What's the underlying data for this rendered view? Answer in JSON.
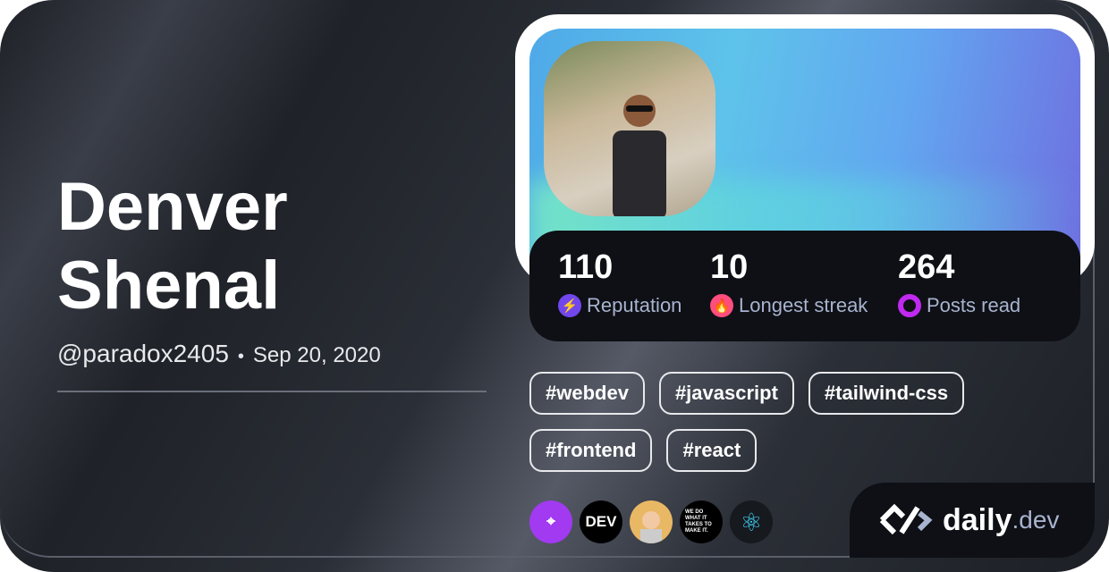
{
  "profile": {
    "first_name": "Denver",
    "last_name": "Shenal",
    "handle": "@paradox2405",
    "separator": "•",
    "joined": "Sep 20, 2020"
  },
  "stats": [
    {
      "value": "110",
      "label": "Reputation",
      "icon": "lightning-icon",
      "color": "#7147ed"
    },
    {
      "value": "10",
      "label": "Longest streak",
      "icon": "flame-icon",
      "color": "#ff4d7e"
    },
    {
      "value": "264",
      "label": "Posts read",
      "icon": "ring-icon",
      "color": "#c029f0"
    }
  ],
  "tags": [
    "#webdev",
    "#javascript",
    "#tailwind-css",
    "#frontend",
    "#react"
  ],
  "squads": [
    {
      "name": "crosshair-squad",
      "color": "#a13af0"
    },
    {
      "name": "DEV",
      "label": "DEV",
      "color": "#000000"
    },
    {
      "name": "avatar-squad",
      "color": "#e9b865"
    },
    {
      "name": "we-do-what-it-takes",
      "label": "WE DO WHAT IT TAKES TO MAKE IT.",
      "color": "#000000"
    },
    {
      "name": "react",
      "color": "#16191e"
    }
  ],
  "brand": {
    "name": "daily",
    "suffix": ".dev"
  }
}
